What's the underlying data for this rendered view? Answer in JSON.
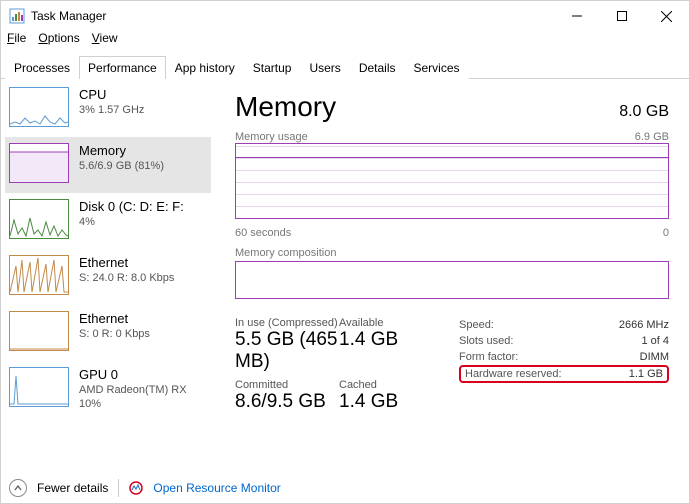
{
  "window": {
    "title": "Task Manager"
  },
  "menu": {
    "file": "File",
    "options": "Options",
    "view": "View"
  },
  "tabs": {
    "processes": "Processes",
    "performance": "Performance",
    "app_history": "App history",
    "startup": "Startup",
    "users": "Users",
    "details": "Details",
    "services": "Services"
  },
  "sidebar": [
    {
      "title": "CPU",
      "sub": "3%  1.57 GHz",
      "kind": "cpu"
    },
    {
      "title": "Memory",
      "sub": "5.6/6.9 GB (81%)",
      "kind": "mem",
      "selected": true
    },
    {
      "title": "Disk 0 (C: D: E: F:",
      "sub": "4%",
      "kind": "disk"
    },
    {
      "title": "Ethernet",
      "sub": "S: 24.0  R: 8.0 Kbps",
      "kind": "eth"
    },
    {
      "title": "Ethernet",
      "sub": "S: 0  R: 0 Kbps",
      "kind": "eth"
    },
    {
      "title": "GPU 0",
      "sub": "AMD Radeon(TM) RX",
      "sub2": "10%",
      "kind": "gpu"
    }
  ],
  "main": {
    "title": "Memory",
    "total": "8.0 GB",
    "usage_label": "Memory usage",
    "usage_max": "6.9 GB",
    "time_left": "60 seconds",
    "time_right": "0",
    "composition_label": "Memory composition",
    "stats": {
      "in_use_lbl": "In use (Compressed)",
      "in_use_val": "5.5 GB (465 MB)",
      "available_lbl": "Available",
      "available_val": "1.4 GB",
      "committed_lbl": "Committed",
      "committed_val": "8.6/9.5 GB",
      "cached_lbl": "Cached",
      "cached_val": "1.4 GB"
    },
    "right": {
      "speed_lbl": "Speed:",
      "speed_val": "2666 MHz",
      "slots_lbl": "Slots used:",
      "slots_val": "1 of 4",
      "form_lbl": "Form factor:",
      "form_val": "DIMM",
      "hw_lbl": "Hardware reserved:",
      "hw_val": "1.1 GB"
    }
  },
  "footer": {
    "fewer": "Fewer details",
    "rm": "Open Resource Monitor"
  }
}
